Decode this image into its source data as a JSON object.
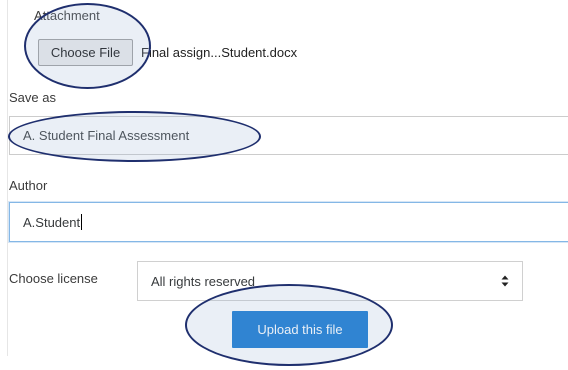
{
  "attachment": {
    "label": "Attachment",
    "choose_file_label": "Choose File",
    "filename": "Final assign...Student.docx"
  },
  "save_as": {
    "label": "Save as",
    "value": "A. Student Final Assessment"
  },
  "author": {
    "label": "Author",
    "value": "A.Student"
  },
  "license": {
    "label": "Choose license",
    "selected": "All rights reserved",
    "arrow_icon": "updown-chevron-icon"
  },
  "upload": {
    "label": "Upload this file"
  },
  "colors": {
    "primary_button": "#1177d1",
    "highlight_ellipse": "#1f2f6e"
  }
}
